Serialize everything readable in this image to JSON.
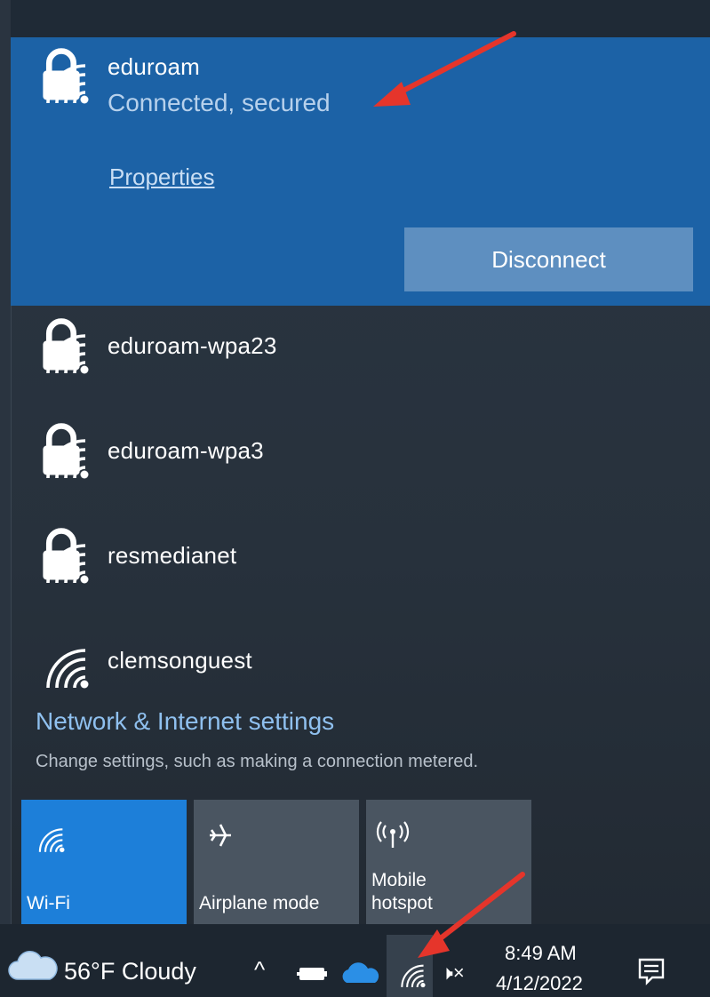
{
  "connected_network": {
    "name": "eduroam",
    "status": "Connected, secured",
    "properties_label": "Properties",
    "disconnect_label": "Disconnect",
    "icon": "wifi-secured-icon"
  },
  "networks": [
    {
      "name": "eduroam-wpa23",
      "icon": "wifi-secured-icon"
    },
    {
      "name": "eduroam-wpa3",
      "icon": "wifi-secured-icon"
    },
    {
      "name": "resmedianet",
      "icon": "wifi-secured-icon"
    },
    {
      "name": "clemsonguest",
      "icon": "wifi-icon"
    }
  ],
  "settings": {
    "title": "Network & Internet settings",
    "subtitle": "Change settings, such as making a connection metered."
  },
  "quick_actions": [
    {
      "label": "Wi-Fi",
      "icon": "wifi-icon",
      "active": true
    },
    {
      "label": "Airplane mode",
      "icon": "airplane-icon",
      "active": false
    },
    {
      "label_line1": "Mobile",
      "label_line2": "hotspot",
      "icon": "hotspot-icon",
      "active": false
    }
  ],
  "taskbar": {
    "weather": "56°F  Cloudy",
    "time": "8:49 AM",
    "date": "4/12/2022",
    "volume_glyph": "🕨×"
  },
  "colors": {
    "selected_bg": "#1c62a6",
    "tile_active": "#1d7fd9",
    "tile_inactive": "#4a5561",
    "link": "#8fc0ef",
    "arrow": "#e5352b"
  }
}
